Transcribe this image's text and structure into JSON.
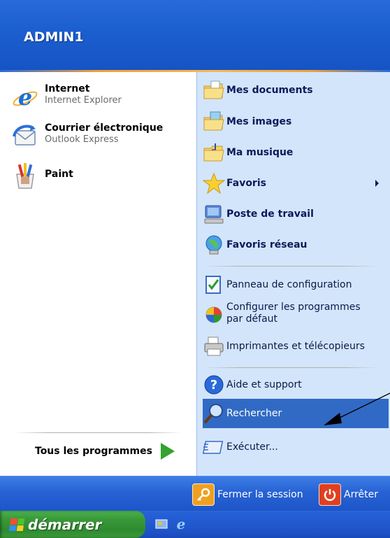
{
  "header": {
    "user_name": "ADMIN1"
  },
  "pinned": [
    {
      "title": "Internet",
      "subtitle": "Internet Explorer",
      "icon": "internet-explorer-icon"
    },
    {
      "title": "Courrier électronique",
      "subtitle": "Outlook Express",
      "icon": "outlook-express-icon"
    },
    {
      "title": "Paint",
      "subtitle": "",
      "icon": "paint-icon"
    }
  ],
  "all_programs": {
    "label": "Tous les programmes",
    "icon": "green-arrow-icon"
  },
  "right_items": [
    {
      "label": "Mes documents",
      "icon": "my-documents-folder-icon",
      "bold": true
    },
    {
      "label": "Mes images",
      "icon": "my-pictures-folder-icon",
      "bold": true
    },
    {
      "label": "Ma musique",
      "icon": "my-music-folder-icon",
      "bold": true
    },
    {
      "label": "Favoris",
      "icon": "favorites-star-icon",
      "bold": true
    },
    {
      "label": "Poste de travail",
      "icon": "my-computer-icon",
      "bold": true
    },
    {
      "label": "Favoris réseau",
      "icon": "network-places-icon",
      "bold": true
    },
    {
      "label": "Panneau de configuration",
      "icon": "control-panel-icon",
      "bold": false
    },
    {
      "label": "Configurer les programmes par défaut",
      "line1": "Configurer les programmes",
      "line2": "par défaut",
      "icon": "default-programs-icon",
      "bold": false
    },
    {
      "label": "Imprimantes et télécopieurs",
      "icon": "printer-icon",
      "bold": false
    },
    {
      "label": "Aide et support",
      "icon": "help-icon",
      "bold": false
    },
    {
      "label": "Rechercher",
      "icon": "search-icon",
      "bold": false,
      "highlighted": true
    },
    {
      "label": "Exécuter...",
      "icon": "run-icon",
      "bold": false
    }
  ],
  "footer": {
    "logoff_label": "Fermer la session",
    "shutdown_label": "Arrêter"
  },
  "taskbar": {
    "start_label": "démarrer"
  },
  "colors": {
    "header_blue": "#1c5fd0",
    "right_pane": "#d3e5fa",
    "highlight": "#316ac5",
    "start_green": "#3a9a3a"
  }
}
